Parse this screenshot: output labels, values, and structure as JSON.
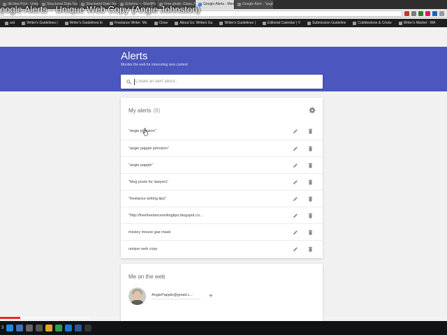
{
  "video_title": "oogle Alerts - Unique Web Copy (Angie Johnston)",
  "browser": {
    "tabs": [
      {
        "label": "dd Idea Post - Uniqu",
        "active": false
      },
      {
        "label": "Structured Data Testing",
        "active": false
      },
      {
        "label": "Structured Data Testing",
        "active": false
      },
      {
        "label": "Schema — WordPress.",
        "active": false
      },
      {
        "label": "Free photo: Glass, Art,",
        "active": false
      },
      {
        "label": "Google Alerts - Monito",
        "active": true
      },
      {
        "label": "Google Alert - \"angie j",
        "active": false
      }
    ],
    "bookmarks": [
      "ard",
      "Writer's Guidelines |",
      "Writer's Guidelines fo",
      "Freelance Writer: Mo",
      "Close",
      "About Us: Writers Gu",
      "Writer's Guidelines |",
      "Editorial Calendar | V",
      "Submission Guideline",
      "Cobblestone & Cricke",
      "Writer's Market - WA"
    ]
  },
  "header": {
    "title": "Alerts",
    "subtitle": "Monitor the web for interesting new content",
    "search_placeholder": "Create an alert about...",
    "accent_color": "#4b56be"
  },
  "my_alerts": {
    "title": "My alerts",
    "count": "(8)",
    "items": [
      "\"angie johnston\"",
      "\"angie papple johnston\"",
      "\"angie papple\"",
      "\"blog posts for lawyers\"",
      "\"freelance writing tips\"",
      "\"http://freefreelancewritingtips.blogspot.co...",
      "mickey mouse gas mask",
      "unique web copy"
    ]
  },
  "me_on_web": {
    "title": "Me on the web",
    "email": "AngiePapple@gmail.c..."
  },
  "icons": {
    "search": "search-icon",
    "settings": "gear-icon",
    "edit": "pencil-icon",
    "delete": "trash-icon",
    "add": "plus-icon"
  },
  "player": {
    "progress": 0.045,
    "buffered": 0.2,
    "taskbar_label": "3",
    "progress_color": "#e52d27"
  }
}
